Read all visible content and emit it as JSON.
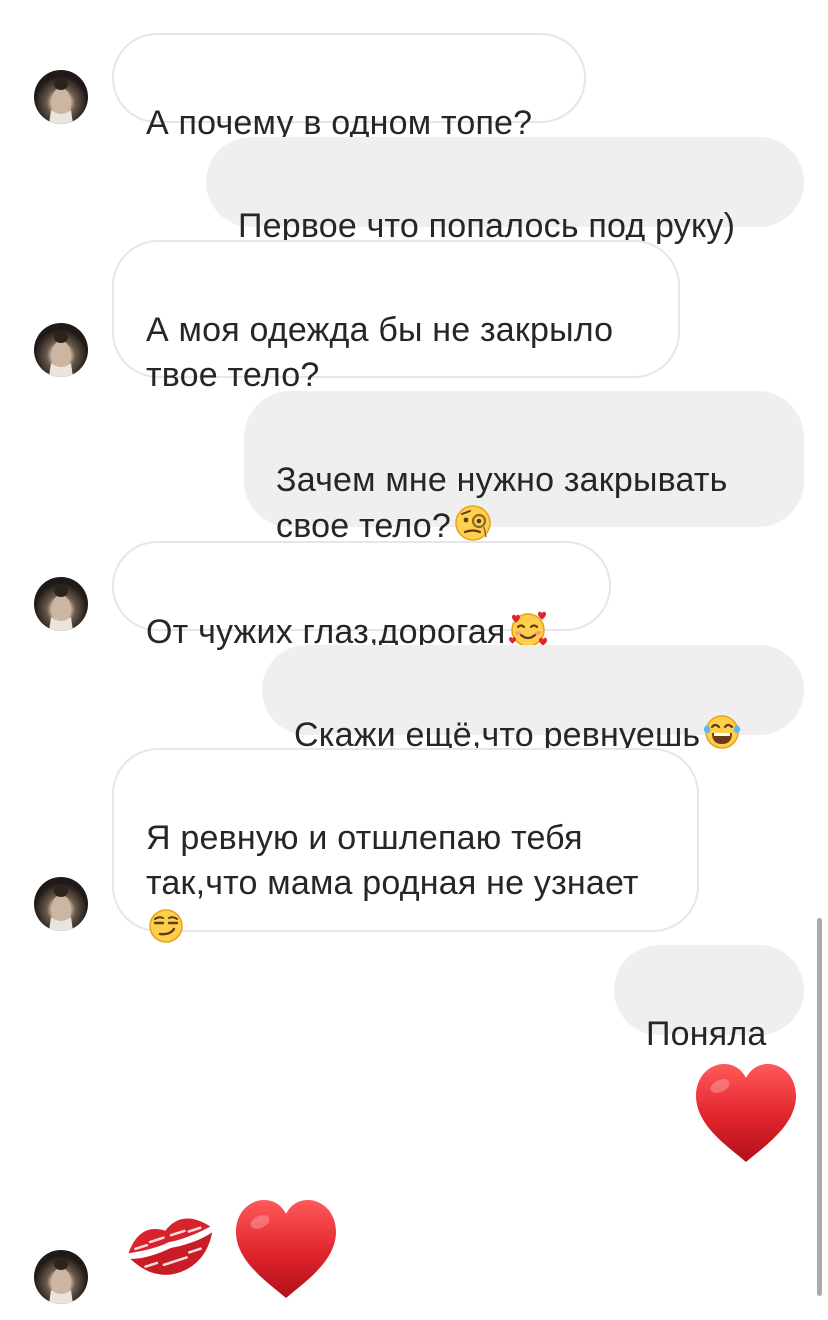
{
  "messages": [
    {
      "side": "in",
      "text": "А почему в одном топе?"
    },
    {
      "side": "out",
      "text": "Первое что попалось под руку)"
    },
    {
      "side": "in",
      "text": "А моя одежда бы не закрыло\nтвое тело?"
    },
    {
      "side": "out",
      "text": "Зачем мне нужно закрывать\nсвое тело?",
      "emoji": "face-with-monocle-icon"
    },
    {
      "side": "in",
      "text": "От чужих глаз,дорогая",
      "emoji": "smiling-face-with-hearts-icon"
    },
    {
      "side": "out",
      "text": "Скажи ещё,что ревнуешь",
      "emoji": "tears-of-joy-icon"
    },
    {
      "side": "in",
      "text": "Я ревную и отшлепаю тебя\nтак,что мама родная не узнает",
      "emoji": "smirking-face-icon"
    },
    {
      "side": "out",
      "text": "Поняла"
    },
    {
      "side": "out",
      "big_emoji": "red-heart-icon"
    },
    {
      "side": "in",
      "big_emoji": [
        "kiss-mark-icon",
        "red-heart-icon"
      ]
    }
  ],
  "colors": {
    "incoming_bg": "#ffffff",
    "incoming_border": "#e6e6e6",
    "outgoing_bg": "#efefef",
    "text": "#262626",
    "heart": "#e0242c"
  }
}
